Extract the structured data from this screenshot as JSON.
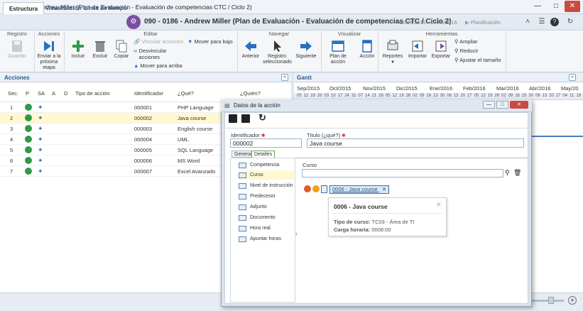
{
  "window": {
    "title": "090 - 0186 - Andrew Miller (Plan de Evaluación - Evaluación de competencias CTC / Ciclo 2)"
  },
  "top_tabs": [
    "Estructura",
    "Visualización",
    "Línea de tiempo"
  ],
  "document": {
    "title": "090 - 0186 - Andrew Miller (Plan de Evaluación - Evaluación de competencias CTC / Ciclo 2)",
    "dates": "02/09/2015 - 17/05/2016",
    "stage": "Planificación"
  },
  "ribbon": {
    "groups": [
      "Registro",
      "Acciones",
      "Editar",
      "Navegar",
      "Visualizar",
      "Herramientas"
    ],
    "guardar": "Guardar",
    "enviar": "Enviar a la próxima etapa",
    "incluir": "Incluir",
    "excluir": "Excluir",
    "copiar": "Copiar",
    "vincular": "Vincular acciones",
    "desvincular": "Desvincular acciones",
    "mover_abajo": "Mover para bajo",
    "mover_arriba": "Mover para arriba",
    "anterior": "Anterior",
    "registro_sel": "Registro seleccionado",
    "siguiente": "Siguiente",
    "plan_accion": "Plan de acción",
    "accion": "Acción",
    "reportes": "Reportes",
    "importar": "Importar",
    "exportar": "Exportar",
    "ampliar": "Ampliar",
    "reducir": "Reducir",
    "ajustar": "Ajustar el tamaño"
  },
  "acciones_panel": {
    "title": "Acciones",
    "columns": [
      "Sec.",
      "P",
      "SA",
      "A",
      "D",
      "Tipo de acción",
      "Identificador",
      "¿Qué?",
      "¿Quién?"
    ],
    "rows": [
      {
        "sec": "1",
        "id": "000001",
        "que": "PHP Language",
        "selected": false
      },
      {
        "sec": "2",
        "id": "000002",
        "que": "Java course",
        "selected": true
      },
      {
        "sec": "3",
        "id": "000003",
        "que": "English course",
        "selected": false
      },
      {
        "sec": "4",
        "id": "000004",
        "que": "UML",
        "selected": false
      },
      {
        "sec": "5",
        "id": "000005",
        "que": "SQL Language",
        "selected": false
      },
      {
        "sec": "6",
        "id": "000006",
        "que": "MS Word",
        "selected": false
      },
      {
        "sec": "7",
        "id": "000007",
        "que": "Excel Avanzado",
        "selected": false
      }
    ]
  },
  "gantt": {
    "title": "Gantt",
    "months": [
      "Sep/2015",
      "Oct/2015",
      "Nov/2015",
      "Dic/2015",
      "Ene/2016",
      "Feb/2016",
      "Mar/2016",
      "Abr/2016",
      "May/20"
    ],
    "days": [
      "05",
      "12",
      "19",
      "26",
      "03",
      "10",
      "17",
      "24",
      "31",
      "07",
      "14",
      "21",
      "28",
      "05",
      "12",
      "19",
      "26",
      "02",
      "09",
      "16",
      "23",
      "30",
      "06",
      "13",
      "20",
      "27",
      "05",
      "12",
      "19",
      "26",
      "02",
      "09",
      "16",
      "23",
      "30",
      "06",
      "13",
      "20",
      "27",
      "04",
      "11",
      "18"
    ]
  },
  "modal": {
    "title": "Datos de la acción",
    "identificador_label": "Identificador",
    "identificador_value": "000002",
    "titulo_label": "Título (¿qué?)",
    "titulo_value": "Java course",
    "tabs": [
      "General",
      "Detalles"
    ],
    "nav": [
      "Competencia",
      "Curso",
      "Nivel de instrucción",
      "Predecesor",
      "Adjunto",
      "Documento",
      "Hora real",
      "Apuntar horas"
    ],
    "curso_label": "Curso",
    "curso_tag": "0006 - Java course",
    "tooltip": {
      "title": "0006 - Java course",
      "tipo_label": "Tipo de curso:",
      "tipo_value": "TC03 - Área de TI",
      "carga_label": "Carga horaria:",
      "carga_value": "0008:00"
    }
  },
  "colors": {
    "accent": "#2a5a8a",
    "selected_row": "#fff8d1",
    "status_green": "#2f9a4a",
    "purple_badge": "#7a4ea3"
  }
}
